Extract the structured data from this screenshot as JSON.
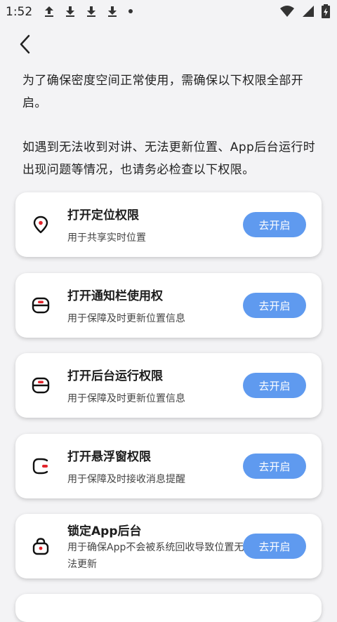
{
  "status_bar": {
    "time": "1:52",
    "icons": [
      "upload-icon",
      "download-icon",
      "download-icon",
      "download-icon",
      "dot-icon"
    ],
    "right_icons": [
      "wifi-icon",
      "cellular-signal-icon",
      "battery-icon"
    ]
  },
  "intro": {
    "paragraph1": "为了确保密度空间正常使用，需确保以下权限全部开启。",
    "paragraph2": "如遇到无法收到对讲、无法更新位置、App后台运行时出现问题等情况，也请务必检查以下权限。"
  },
  "permissions": [
    {
      "title": "打开定位权限",
      "desc": "用于共享实时位置",
      "button": "去开启",
      "icon": "location-pin-icon"
    },
    {
      "title": "打开通知栏使用权",
      "desc": "用于保障及时更新位置信息",
      "button": "去开启",
      "icon": "notification-icon"
    },
    {
      "title": "打开后台运行权限",
      "desc": "用于保障及时更新位置信息",
      "button": "去开启",
      "icon": "background-run-icon"
    },
    {
      "title": "打开悬浮窗权限",
      "desc": "用于保障及时接收消息提醒",
      "button": "去开启",
      "icon": "floating-window-icon"
    },
    {
      "title": "锁定App后台",
      "desc": "用于确保App不会被系统回收导致位置无法更新",
      "button": "去开启",
      "icon": "lock-icon"
    }
  ],
  "colors": {
    "accent": "#5f9aef",
    "icon_red": "#e3242b",
    "background": "#f3f3f5"
  }
}
